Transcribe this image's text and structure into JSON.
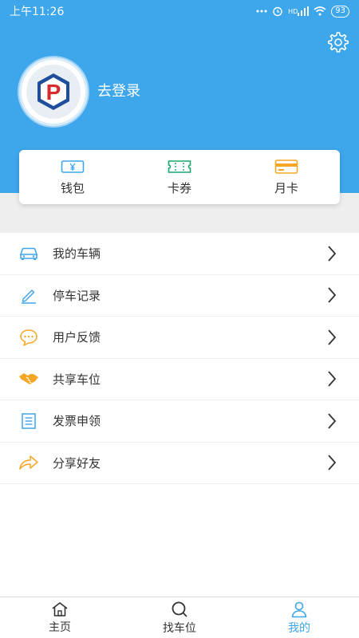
{
  "status_bar": {
    "time": "上午11:26",
    "signal_text": "HD",
    "battery": "93"
  },
  "header": {
    "login_text": "去登录",
    "avatar_logo_letter": "P"
  },
  "wallet": [
    {
      "label": "钱包",
      "icon": "wallet-yen-icon",
      "color": "#3ea6ea"
    },
    {
      "label": "卡券",
      "icon": "coupon-icon",
      "color": "#19a66b"
    },
    {
      "label": "月卡",
      "icon": "card-icon",
      "color": "#f5a623"
    }
  ],
  "menu": [
    {
      "label": "我的车辆",
      "icon": "car-icon",
      "color": "#3ea6ea"
    },
    {
      "label": "停车记录",
      "icon": "pencil-icon",
      "color": "#3ea6ea"
    },
    {
      "label": "用户反馈",
      "icon": "chat-bubble-icon",
      "color": "#f5a623"
    },
    {
      "label": "共享车位",
      "icon": "handshake-icon",
      "color": "#f5a623"
    },
    {
      "label": "发票申领",
      "icon": "receipt-icon",
      "color": "#3ea6ea"
    },
    {
      "label": "分享好友",
      "icon": "share-arrow-icon",
      "color": "#f5a623"
    }
  ],
  "bottom_nav": [
    {
      "label": "主页",
      "icon": "home-icon",
      "active": false
    },
    {
      "label": "找车位",
      "icon": "search-icon",
      "active": false
    },
    {
      "label": "我的",
      "icon": "user-icon",
      "active": true
    }
  ],
  "colors": {
    "primary": "#3ea6ea",
    "active_tab": "#3ea6ea"
  }
}
